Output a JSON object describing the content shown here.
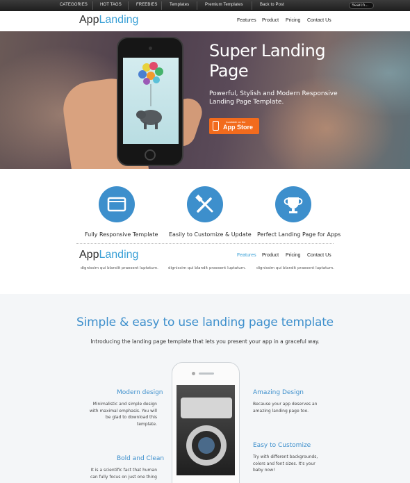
{
  "topbar": {
    "links": [
      "CATEGORIES",
      "HOT TAGS",
      "FREEBIES",
      "Templates",
      "Premium Templates",
      "Back to Post"
    ],
    "search_placeholder": "Search..."
  },
  "header": {
    "logo_part1": "App",
    "logo_part2": "Landing",
    "nav": [
      "Features",
      "Product",
      "Pricing",
      "Contact Us"
    ]
  },
  "hero": {
    "title": "Super Landing Page",
    "subtitle": "Powerful, Stylish and Modern Responsive Landing Page Template.",
    "button_small": "Available on the",
    "button_big": "App Store"
  },
  "features": [
    {
      "title": "Fully Responsive Template",
      "icon": "browser-window-icon",
      "desc": "dignissim qui blandit praesent luptatum."
    },
    {
      "title": "Easily to Customize & Update",
      "icon": "tools-icon",
      "desc": "dignissim qui blandit praesent luptatum."
    },
    {
      "title": "Perfect Landing Page for Apps",
      "icon": "trophy-icon",
      "desc": "dignissim qui blandit praesent luptatum."
    }
  ],
  "section2": {
    "heading": "Simple & easy to use landing page template",
    "intro": "Introducing the landing page template that lets you present your app in a graceful way.",
    "left": [
      {
        "title": "Modern design",
        "lines": [
          "Minimalistic and simple design",
          "with maximal emphasis. You will",
          "be glad to download this",
          "template."
        ]
      },
      {
        "title": "Bold and Clean",
        "lines": [
          "It is a scientific fact that human",
          "can fully focus on just one thing"
        ]
      }
    ],
    "right": [
      {
        "title": "Amazing Design",
        "lines": [
          "Because your app deserves an",
          "amazing landing page too."
        ]
      },
      {
        "title": "Easy to Customize",
        "lines": [
          "Try with different backgrounds,",
          "colors and font sizes. It's your",
          "baby now!"
        ]
      }
    ]
  },
  "colors": {
    "accent": "#3d8fcc",
    "logo_blue": "#3aa0d6",
    "cta": "#f26b1d",
    "topbar": "#2a2a2a"
  }
}
